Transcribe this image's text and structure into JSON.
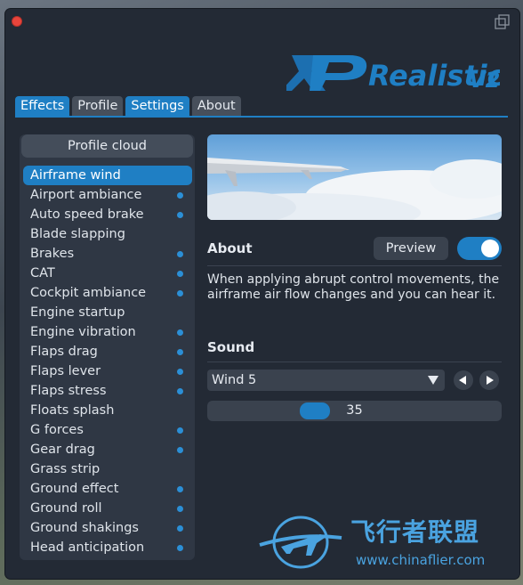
{
  "window": {
    "logo_text": "XPRealisticV2"
  },
  "tabs": [
    {
      "label": "Effects",
      "active": true
    },
    {
      "label": "Profile",
      "active": false
    },
    {
      "label": "Settings",
      "active": true
    },
    {
      "label": "About",
      "active": false
    }
  ],
  "left_panel": {
    "profile_cloud_label": "Profile cloud",
    "effects": [
      {
        "label": "Airframe wind",
        "selected": true,
        "dot": false
      },
      {
        "label": "Airport ambiance",
        "selected": false,
        "dot": true
      },
      {
        "label": "Auto speed brake",
        "selected": false,
        "dot": true
      },
      {
        "label": "Blade slapping",
        "selected": false,
        "dot": false
      },
      {
        "label": "Brakes",
        "selected": false,
        "dot": true
      },
      {
        "label": "CAT",
        "selected": false,
        "dot": true
      },
      {
        "label": "Cockpit ambiance",
        "selected": false,
        "dot": true
      },
      {
        "label": "Engine startup",
        "selected": false,
        "dot": false
      },
      {
        "label": "Engine vibration",
        "selected": false,
        "dot": true
      },
      {
        "label": "Flaps drag",
        "selected": false,
        "dot": true
      },
      {
        "label": "Flaps lever",
        "selected": false,
        "dot": true
      },
      {
        "label": "Flaps stress",
        "selected": false,
        "dot": true
      },
      {
        "label": "Floats splash",
        "selected": false,
        "dot": false
      },
      {
        "label": "G forces",
        "selected": false,
        "dot": true
      },
      {
        "label": "Gear drag",
        "selected": false,
        "dot": true
      },
      {
        "label": "Grass strip",
        "selected": false,
        "dot": false
      },
      {
        "label": "Ground effect",
        "selected": false,
        "dot": true
      },
      {
        "label": "Ground roll",
        "selected": false,
        "dot": true
      },
      {
        "label": "Ground shakings",
        "selected": false,
        "dot": true
      },
      {
        "label": "Head anticipation",
        "selected": false,
        "dot": true
      }
    ]
  },
  "details": {
    "about_heading": "About",
    "preview_label": "Preview",
    "preview_enabled": true,
    "description": "When applying abrupt control movements, the airframe air flow changes and you can hear it.",
    "sound_heading": "Sound",
    "sound_selected": "Wind 5",
    "volume_value": "35",
    "volume_fraction": 0.35
  },
  "watermark": {
    "text_cn": "飞行者联盟",
    "url": "www.chinaflier.com"
  },
  "colors": {
    "accent": "#1f7fc4",
    "background": "#232a35",
    "close": "#e8453c"
  }
}
